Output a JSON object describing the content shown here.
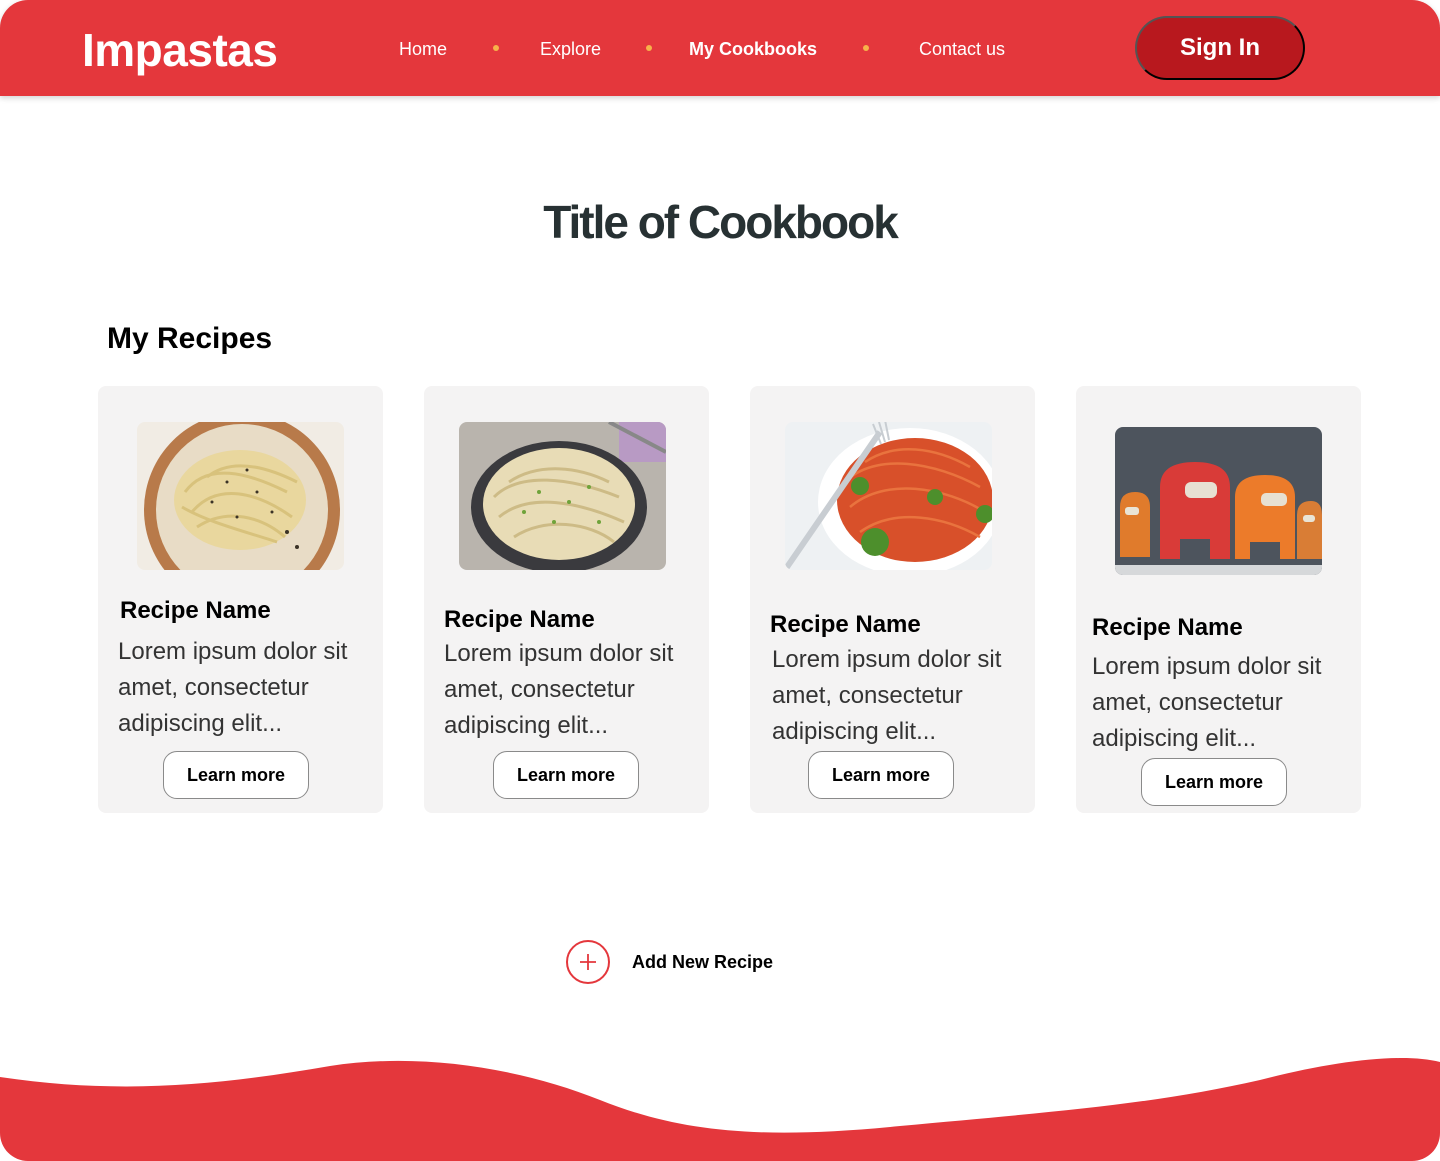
{
  "header": {
    "logo": "Impastas",
    "nav": [
      {
        "label": "Home"
      },
      {
        "label": "Explore"
      },
      {
        "label": "My Cookbooks"
      },
      {
        "label": "Contact us"
      }
    ],
    "sign_in": "Sign In"
  },
  "main": {
    "title": "Title of Cookbook",
    "section_title": "My Recipes",
    "recipes": [
      {
        "name": "Recipe Name",
        "description": "Lorem ipsum dolor sit amet, consectetur adipiscing elit...",
        "button": "Learn more",
        "image": "fettuccine-alfredo-bowl"
      },
      {
        "name": "Recipe Name",
        "description": "Lorem ipsum dolor sit amet, consectetur adipiscing elit...",
        "button": "Learn more",
        "image": "creamy-pasta-skillet"
      },
      {
        "name": "Recipe Name",
        "description": "Lorem ipsum dolor sit amet, consectetur adipiscing elit...",
        "button": "Learn more",
        "image": "spaghetti-tomato-basil"
      },
      {
        "name": "Recipe Name",
        "description": "Lorem ipsum dolor sit amet, consectetur adipiscing elit...",
        "button": "Learn more",
        "image": "crewmate-cookies"
      }
    ],
    "add_recipe": "Add New Recipe"
  },
  "colors": {
    "brand_red": "#e4373c",
    "button_red": "#b8181e",
    "nav_dot": "#f7b24a",
    "title_text": "#273133",
    "card_bg": "#f4f3f3"
  }
}
